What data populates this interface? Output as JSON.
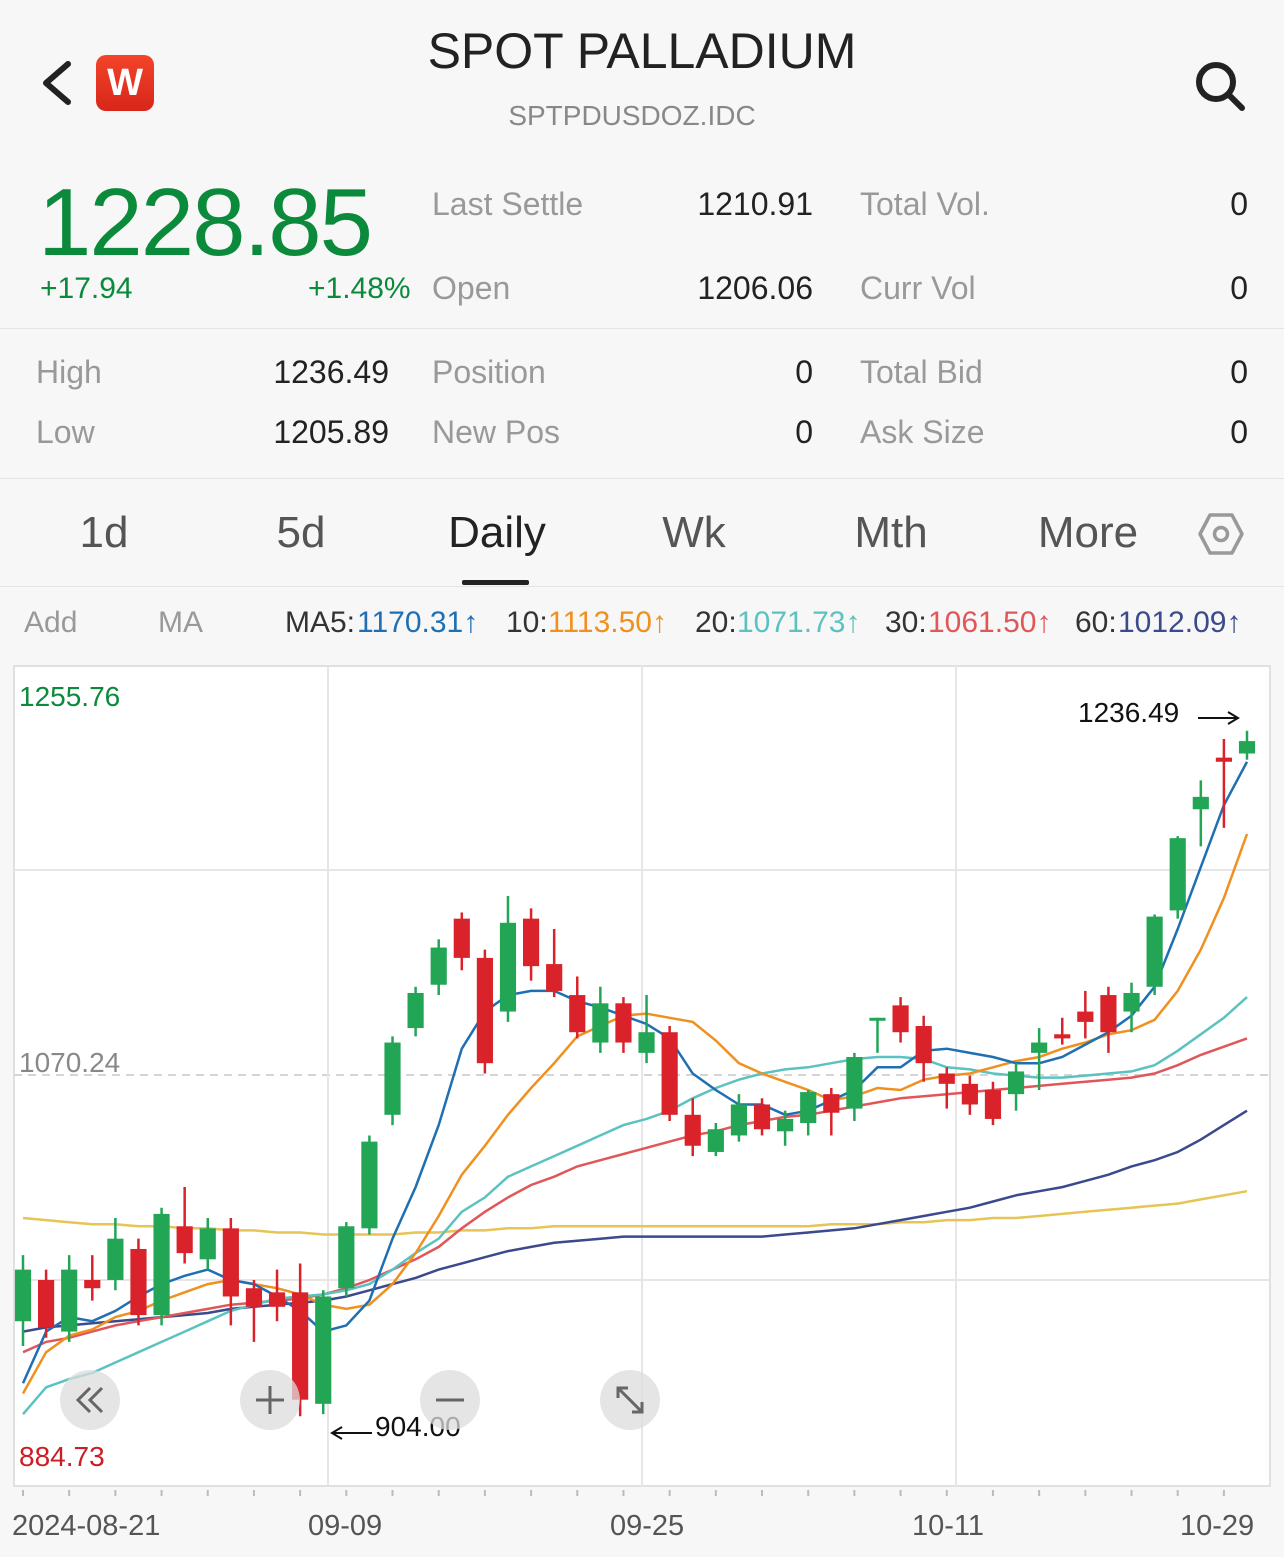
{
  "header": {
    "title": "SPOT PALLADIUM",
    "symbol": "SPTPDUSDOZ.IDC",
    "logo_text": "W",
    "icons": [
      "back-chevron-icon",
      "search-icon"
    ]
  },
  "quote": {
    "price": "1228.85",
    "change": "+17.94",
    "change_pct": "+1.48%",
    "fields": {
      "last_settle_label": "Last Settle",
      "last_settle": "1210.91",
      "open_label": "Open",
      "open": "1206.06",
      "total_vol_label": "Total Vol.",
      "total_vol": "0",
      "curr_vol_label": "Curr Vol",
      "curr_vol": "0",
      "high_label": "High",
      "high": "1236.49",
      "low_label": "Low",
      "low": "1205.89",
      "position_label": "Position",
      "position": "0",
      "new_pos_label": "New Pos",
      "new_pos": "0",
      "total_bid_label": "Total Bid",
      "total_bid": "0",
      "ask_size_label": "Ask Size",
      "ask_size": "0"
    }
  },
  "tabs": [
    "1d",
    "5d",
    "Daily",
    "Wk",
    "Mth",
    "More"
  ],
  "active_tab": "Daily",
  "ma_bar": {
    "add": "Add",
    "ma": "MA",
    "ma5_label": "MA5:",
    "ma5": "1170.31↑",
    "ma10_label": "10:",
    "ma10": "1113.50↑",
    "ma20_label": "20:",
    "ma20": "1071.73↑",
    "ma30_label": "30:",
    "ma30": "1061.50↑",
    "ma60_label": "60:",
    "ma60": "1012.09↑"
  },
  "colors": {
    "up": "#22a555",
    "down": "#d9222a",
    "ma5": "#1f6fb2",
    "ma10": "#f0901e",
    "ma20": "#5cc2c0",
    "ma30": "#e0575a",
    "ma60": "#3a4a8c",
    "ma_long": "#e6c455"
  },
  "chart_data": {
    "type": "candlestick",
    "y_top_label": "1255.76",
    "y_mid_label": "1070.24",
    "y_bottom_label": "884.73",
    "ylim": [
      884.73,
      1255.76
    ],
    "max_marker": "1236.49",
    "min_marker": "904.00",
    "x_labels": [
      "2024-08-21",
      "09-09",
      "09-25",
      "10-11",
      "10-29"
    ],
    "candles": [
      [
        950,
        975,
        938,
        982
      ],
      [
        970,
        947,
        942,
        975
      ],
      [
        945,
        975,
        940,
        982
      ],
      [
        970,
        966,
        960,
        982
      ],
      [
        970,
        990,
        965,
        1000
      ],
      [
        985,
        953,
        948,
        990
      ],
      [
        953,
        1002,
        948,
        1005
      ],
      [
        996,
        983,
        978,
        1015
      ],
      [
        980,
        995,
        975,
        1000
      ],
      [
        995,
        962,
        948,
        1000
      ],
      [
        966,
        957,
        940,
        970
      ],
      [
        964,
        957,
        950,
        975
      ],
      [
        964,
        912,
        904,
        978
      ],
      [
        910,
        962,
        905,
        965
      ],
      [
        966,
        996,
        962,
        998
      ],
      [
        995,
        1037,
        992,
        1040
      ],
      [
        1050,
        1085,
        1045,
        1088
      ],
      [
        1092,
        1109,
        1088,
        1112
      ],
      [
        1113,
        1131,
        1108,
        1135
      ],
      [
        1145,
        1126,
        1120,
        1148
      ],
      [
        1126,
        1075,
        1070,
        1130
      ],
      [
        1100,
        1143,
        1095,
        1156
      ],
      [
        1145,
        1122,
        1115,
        1150
      ],
      [
        1123,
        1110,
        1107,
        1140
      ],
      [
        1108,
        1090,
        1087,
        1117
      ],
      [
        1085,
        1104,
        1080,
        1112
      ],
      [
        1104,
        1085,
        1080,
        1107
      ],
      [
        1080,
        1090,
        1075,
        1108
      ],
      [
        1090,
        1050,
        1047,
        1093
      ],
      [
        1050,
        1035,
        1030,
        1058
      ],
      [
        1032,
        1043,
        1030,
        1046
      ],
      [
        1040,
        1055,
        1037,
        1060
      ],
      [
        1055,
        1043,
        1040,
        1058
      ],
      [
        1042,
        1048,
        1035,
        1052
      ],
      [
        1046,
        1061,
        1040,
        1062
      ],
      [
        1060,
        1051,
        1040,
        1063
      ],
      [
        1053,
        1078,
        1047,
        1080
      ],
      [
        1096,
        1097,
        1080,
        1097
      ],
      [
        1103,
        1090,
        1085,
        1107
      ],
      [
        1093,
        1075,
        1066,
        1098
      ],
      [
        1070,
        1065,
        1053,
        1073
      ],
      [
        1065,
        1055,
        1050,
        1069
      ],
      [
        1062,
        1048,
        1045,
        1066
      ],
      [
        1060,
        1071,
        1052,
        1075
      ],
      [
        1080,
        1085,
        1062,
        1092
      ],
      [
        1089,
        1087,
        1084,
        1097
      ],
      [
        1100,
        1095,
        1087,
        1110
      ],
      [
        1108,
        1090,
        1080,
        1112
      ],
      [
        1100,
        1109,
        1090,
        1114
      ],
      [
        1112,
        1146,
        1108,
        1147
      ],
      [
        1149,
        1184,
        1145,
        1185
      ],
      [
        1198,
        1204,
        1180,
        1212
      ],
      [
        1223,
        1221,
        1189,
        1232
      ],
      [
        1225,
        1231,
        1222,
        1236
      ]
    ],
    "ma5": [
      920,
      945,
      952,
      950,
      955,
      962,
      968,
      972,
      975,
      970,
      968,
      962,
      955,
      945,
      948,
      960,
      990,
      1015,
      1045,
      1082,
      1100,
      1108,
      1110,
      1110,
      1105,
      1102,
      1098,
      1094,
      1087,
      1070,
      1062,
      1055,
      1055,
      1050,
      1052,
      1057,
      1062,
      1073,
      1073,
      1081,
      1082,
      1080,
      1078,
      1075,
      1075,
      1078,
      1084,
      1090,
      1098,
      1112,
      1140,
      1170,
      1200,
      1221
    ],
    "ma10": [
      915,
      935,
      943,
      946,
      952,
      955,
      960,
      964,
      968,
      970,
      968,
      966,
      963,
      958,
      956,
      958,
      968,
      983,
      1001,
      1021,
      1035,
      1050,
      1063,
      1075,
      1088,
      1093,
      1098,
      1099,
      1097,
      1095,
      1086,
      1075,
      1070,
      1066,
      1062,
      1057,
      1059,
      1063,
      1062,
      1067,
      1069,
      1070,
      1073,
      1076,
      1078,
      1082,
      1085,
      1089,
      1091,
      1096,
      1110,
      1130,
      1155,
      1186
    ],
    "ma20": [
      905,
      918,
      922,
      925,
      930,
      935,
      940,
      945,
      950,
      955,
      958,
      961,
      962,
      963,
      965,
      968,
      975,
      983,
      990,
      1003,
      1010,
      1020,
      1025,
      1030,
      1035,
      1040,
      1045,
      1048,
      1052,
      1058,
      1063,
      1067,
      1070,
      1072,
      1073,
      1075,
      1077,
      1078,
      1078,
      1077,
      1073,
      1072,
      1070,
      1069,
      1068,
      1068,
      1069,
      1070,
      1071,
      1074,
      1081,
      1089,
      1097,
      1107
    ],
    "ma30": [
      935,
      940,
      942,
      945,
      948,
      950,
      952,
      954,
      956,
      958,
      959,
      960,
      961,
      963,
      966,
      970,
      975,
      980,
      986,
      995,
      1003,
      1010,
      1016,
      1020,
      1025,
      1028,
      1031,
      1034,
      1037,
      1040,
      1042,
      1045,
      1047,
      1049,
      1050,
      1052,
      1054,
      1056,
      1058,
      1059,
      1060,
      1061,
      1062,
      1063,
      1064,
      1065,
      1066,
      1067,
      1068,
      1070,
      1074,
      1079,
      1083,
      1087
    ],
    "ma60": [
      945,
      947,
      948,
      949,
      950,
      951,
      952,
      953,
      954,
      956,
      957,
      958,
      959,
      960,
      962,
      965,
      968,
      971,
      975,
      978,
      981,
      984,
      986,
      988,
      989,
      990,
      991,
      991,
      991,
      991,
      991,
      991,
      991,
      992,
      993,
      994,
      995,
      997,
      999,
      1001,
      1003,
      1005,
      1008,
      1011,
      1013,
      1015,
      1018,
      1021,
      1025,
      1028,
      1032,
      1038,
      1045,
      1052
    ],
    "ma_long": [
      1000,
      999,
      998,
      997,
      997,
      996,
      996,
      995,
      995,
      994,
      994,
      993,
      993,
      992,
      992,
      992,
      992,
      993,
      993,
      994,
      994,
      995,
      995,
      996,
      996,
      996,
      996,
      996,
      996,
      996,
      996,
      996,
      996,
      996,
      996,
      997,
      997,
      997,
      998,
      998,
      999,
      999,
      1000,
      1000,
      1001,
      1002,
      1003,
      1004,
      1005,
      1006,
      1007,
      1009,
      1011,
      1013
    ]
  }
}
